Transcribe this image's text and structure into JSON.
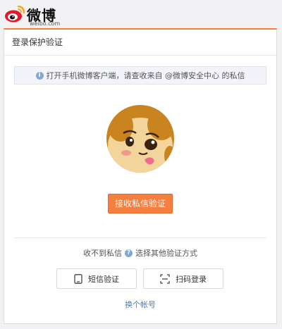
{
  "brand": {
    "name": "微博",
    "domain": "weibo.com",
    "accent_color": "#fa7d3c"
  },
  "card": {
    "title": "登录保护验证",
    "notice": {
      "icon": "info-icon",
      "text": "打开手机微博客户端，请查收来自 @微博安全中心 的私信"
    },
    "avatar": {
      "icon": "avatar-cartoon-icon"
    },
    "primary_button": "接收私信验证",
    "alternatives": {
      "prefix": "收不到私信",
      "icon": "question-icon",
      "suffix": "选择其他验证方式"
    },
    "options": [
      {
        "label": "短信验证",
        "icon": "phone-icon"
      },
      {
        "label": "扫码登录",
        "icon": "scan-icon"
      }
    ],
    "switch_account": "换个帐号"
  }
}
